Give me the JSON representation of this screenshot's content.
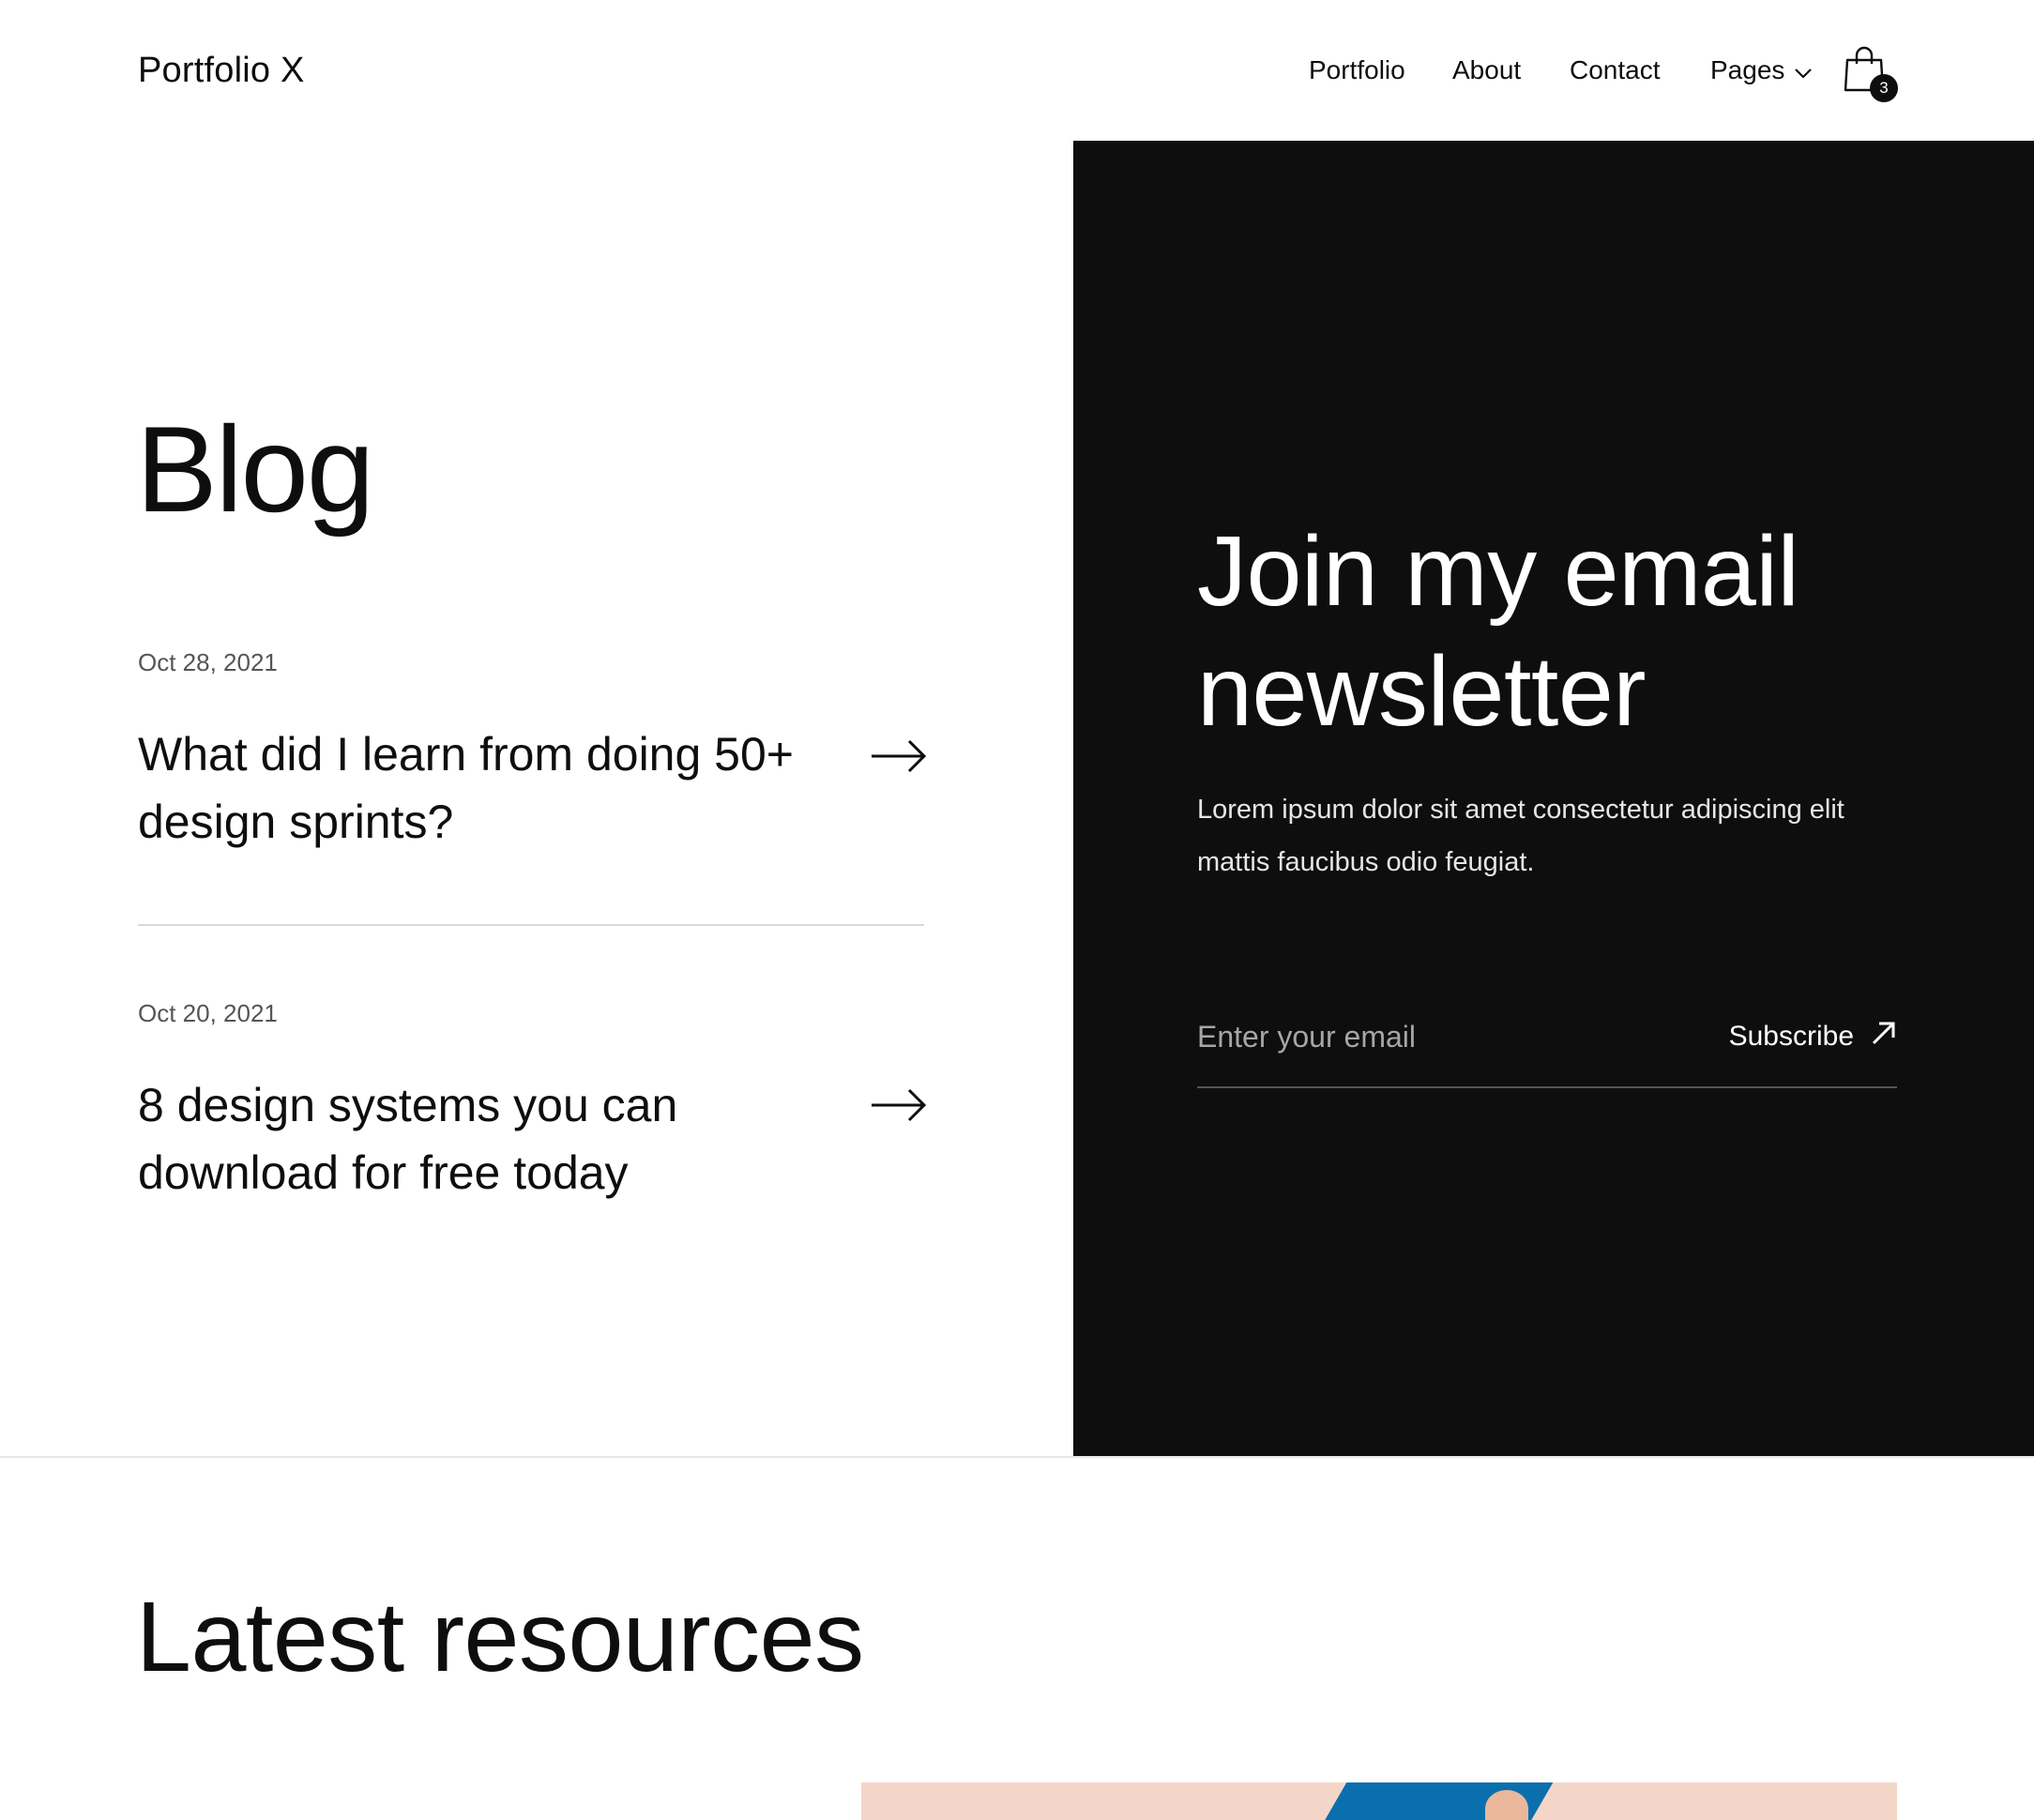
{
  "header": {
    "logo": "Portfolio X",
    "nav": {
      "portfolio": "Portfolio",
      "about": "About",
      "contact": "Contact",
      "pages": "Pages"
    },
    "cart_count": "3",
    "icons": {
      "cart": "shopping-bag-icon",
      "pages_dropdown": "chevron-down-icon"
    }
  },
  "blog": {
    "title": "Blog",
    "posts": [
      {
        "date": "Oct 28, 2021",
        "title": "What did I learn from doing 50+ design sprints?"
      },
      {
        "date": "Oct 20, 2021",
        "title": "8 design systems you can download for free today"
      }
    ]
  },
  "newsletter": {
    "title": "Join my email newsletter",
    "description": "Lorem ipsum dolor sit amet consectetur adipiscing elit mattis faucibus odio feugiat.",
    "input_placeholder": "Enter your email",
    "input_value": "",
    "submit_label": "Subscribe",
    "icons": {
      "submit": "arrow-up-right-icon"
    }
  },
  "resources": {
    "title": "Latest resources"
  },
  "colors": {
    "text": "#0e0e0e",
    "panel_bg": "#0e0e0e",
    "muted": "#555555",
    "divider": "#d9d9d9",
    "resource_image_bg": "#f3d6c8",
    "resource_image_accent": "#0b6fae"
  }
}
